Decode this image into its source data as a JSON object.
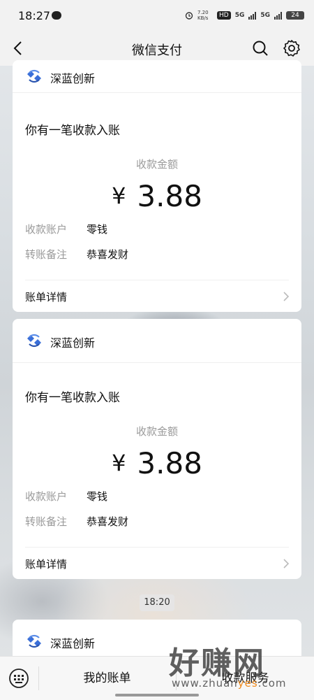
{
  "status_bar": {
    "time": "18:27",
    "net_speed": "7.20 KB/s",
    "hd_badge": "HD",
    "sim1": "5G",
    "sim2": "5G",
    "battery": "24"
  },
  "nav": {
    "title": "微信支付"
  },
  "cards": [
    {
      "brand": "深蓝创新",
      "notice": "你有一笔收款入账",
      "amount_label": "收款金额",
      "currency": "¥",
      "amount": "3.88",
      "account_key": "收款账户",
      "account_value": "零钱",
      "remark_key": "转账备注",
      "remark_value": "恭喜发财",
      "detail_label": "账单详情"
    },
    {
      "brand": "深蓝创新",
      "notice": "你有一笔收款入账",
      "amount_label": "收款金额",
      "currency": "¥",
      "amount": "3.88",
      "account_key": "收款账户",
      "account_value": "零钱",
      "remark_key": "转账备注",
      "remark_value": "恭喜发财",
      "detail_label": "账单详情"
    },
    {
      "brand": "深蓝创新"
    }
  ],
  "timestamp": "18:20",
  "bottom_bar": {
    "tab_bills": "我的账单",
    "tab_service": "收款服务"
  },
  "watermark": {
    "text": "好赚网",
    "url_prefix": "www.zhuan",
    "url_accent": "yes",
    "url_suffix": ".com"
  },
  "icons": [
    "back-icon",
    "search-icon",
    "gear-icon",
    "brand-logo-icon",
    "chevron-right-icon",
    "keyboard-icon"
  ],
  "colors": {
    "brand_blue": "#3a6fd8",
    "page_bg": "#f2f2f2",
    "card_bg": "#ffffff"
  }
}
